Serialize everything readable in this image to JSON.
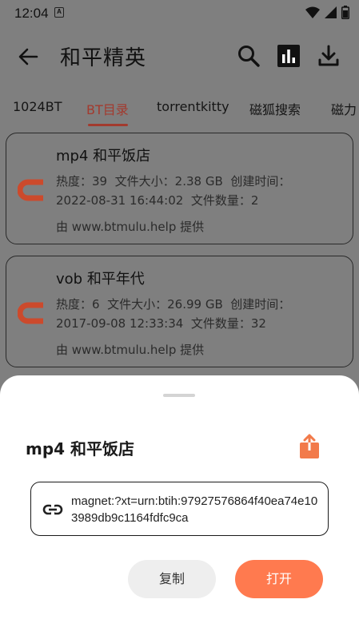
{
  "status_bar": {
    "time": "12:04",
    "notification_letter": "A",
    "icons": [
      "wifi-icon",
      "signal-icon",
      "battery-icon"
    ]
  },
  "app_bar": {
    "title": "和平精英",
    "actions": [
      "search-icon",
      "bar-chart-icon",
      "download-icon"
    ]
  },
  "tabs": [
    {
      "label": "1024BT",
      "active": false
    },
    {
      "label": "BT目录",
      "active": true
    },
    {
      "label": "torrentkitty",
      "active": false
    },
    {
      "label": "磁狐搜索",
      "active": false
    },
    {
      "label": "磁力",
      "active": false
    }
  ],
  "results": [
    {
      "title": "mp4 和平饭店",
      "heat_label": "热度：",
      "heat": "39",
      "size_label": "文件大小：",
      "size": "2.38 GB",
      "created_label": "创建时间：",
      "created": "2022-08-31 16:44:02",
      "count_label": "文件数量：",
      "count": "2",
      "source": "由 www.btmulu.help 提供"
    },
    {
      "title": "vob 和平年代",
      "heat_label": "热度：",
      "heat": "6",
      "size_label": "文件大小：",
      "size": "26.99 GB",
      "created_label": "创建时间：",
      "created": "2017-09-08 12:33:34",
      "count_label": "文件数量：",
      "count": "32",
      "source": "由 www.btmulu.help 提供"
    }
  ],
  "sheet": {
    "title": "mp4 和平饭店",
    "magnet": "magnet:?xt=urn:btih:97927576864f40ea74e103989db9c1164fdfc9ca",
    "copy_label": "复制",
    "open_label": "打开"
  },
  "colors": {
    "accent": "#a33a2e",
    "magnet_icon": "#cc4a2c",
    "open_button": "#ff7a4f",
    "share_icon": "#f27a4a",
    "scrim": "#7f7f7f"
  }
}
